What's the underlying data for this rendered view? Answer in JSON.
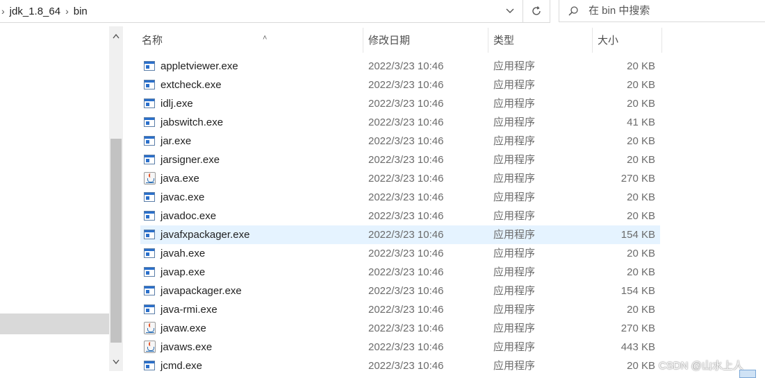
{
  "address_bar": {
    "breadcrumbs": [
      "jdk_1.8_64",
      "bin"
    ],
    "search_placeholder": "在 bin 中搜索"
  },
  "columns": {
    "name": "名称",
    "date": "修改日期",
    "type": "类型",
    "size": "大小"
  },
  "files": [
    {
      "name": "appletviewer.exe",
      "date": "2022/3/23 10:46",
      "type": "应用程序",
      "size": "20 KB",
      "icon": "exe-icon"
    },
    {
      "name": "extcheck.exe",
      "date": "2022/3/23 10:46",
      "type": "应用程序",
      "size": "20 KB",
      "icon": "exe-icon"
    },
    {
      "name": "idlj.exe",
      "date": "2022/3/23 10:46",
      "type": "应用程序",
      "size": "20 KB",
      "icon": "exe-icon"
    },
    {
      "name": "jabswitch.exe",
      "date": "2022/3/23 10:46",
      "type": "应用程序",
      "size": "41 KB",
      "icon": "exe-icon"
    },
    {
      "name": "jar.exe",
      "date": "2022/3/23 10:46",
      "type": "应用程序",
      "size": "20 KB",
      "icon": "exe-icon"
    },
    {
      "name": "jarsigner.exe",
      "date": "2022/3/23 10:46",
      "type": "应用程序",
      "size": "20 KB",
      "icon": "exe-icon"
    },
    {
      "name": "java.exe",
      "date": "2022/3/23 10:46",
      "type": "应用程序",
      "size": "270 KB",
      "icon": "java-icon"
    },
    {
      "name": "javac.exe",
      "date": "2022/3/23 10:46",
      "type": "应用程序",
      "size": "20 KB",
      "icon": "exe-icon"
    },
    {
      "name": "javadoc.exe",
      "date": "2022/3/23 10:46",
      "type": "应用程序",
      "size": "20 KB",
      "icon": "exe-icon"
    },
    {
      "name": "javafxpackager.exe",
      "date": "2022/3/23 10:46",
      "type": "应用程序",
      "size": "154 KB",
      "icon": "exe-icon",
      "selected": true
    },
    {
      "name": "javah.exe",
      "date": "2022/3/23 10:46",
      "type": "应用程序",
      "size": "20 KB",
      "icon": "exe-icon"
    },
    {
      "name": "javap.exe",
      "date": "2022/3/23 10:46",
      "type": "应用程序",
      "size": "20 KB",
      "icon": "exe-icon"
    },
    {
      "name": "javapackager.exe",
      "date": "2022/3/23 10:46",
      "type": "应用程序",
      "size": "154 KB",
      "icon": "exe-icon"
    },
    {
      "name": "java-rmi.exe",
      "date": "2022/3/23 10:46",
      "type": "应用程序",
      "size": "20 KB",
      "icon": "exe-icon"
    },
    {
      "name": "javaw.exe",
      "date": "2022/3/23 10:46",
      "type": "应用程序",
      "size": "270 KB",
      "icon": "java-icon"
    },
    {
      "name": "javaws.exe",
      "date": "2022/3/23 10:46",
      "type": "应用程序",
      "size": "443 KB",
      "icon": "java-icon"
    },
    {
      "name": "jcmd.exe",
      "date": "2022/3/23 10:46",
      "type": "应用程序",
      "size": "20 KB",
      "icon": "exe-icon"
    }
  ],
  "watermark": "CSDN @山水上人",
  "colors": {
    "selection": "#e5f3ff",
    "nav_selected": "#d9d9d9",
    "exe_icon_blue": "#2a6fcb"
  }
}
